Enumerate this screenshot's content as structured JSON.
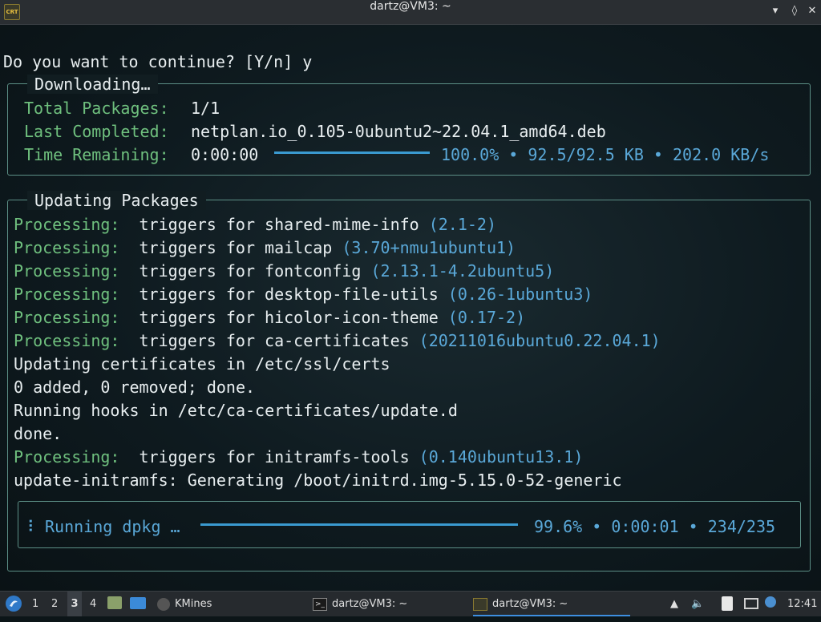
{
  "window": {
    "title": "dartz@VM3: ~",
    "app_icon": "CRT"
  },
  "terminal": {
    "prompt_line": "Do you want to continue? [Y/n] y",
    "downloading": {
      "legend": "Downloading…",
      "total_label": "Total Packages:",
      "total_value": "1/1",
      "last_label": "Last Completed:",
      "last_value": "netplan.io_0.105-0ubuntu2~22.04.1_amd64.deb",
      "remaining_label": "Time Remaining:",
      "remaining_value": "0:00:00",
      "progress": 1.0,
      "stats": "100.0% • 92.5/92.5 KB • 202.0 KB/s"
    },
    "updating": {
      "legend": "Updating Packages",
      "lines": [
        {
          "kind": "proc",
          "label": "Processing:",
          "text": "triggers for shared-mime-info ",
          "ver": "(2.1-2)"
        },
        {
          "kind": "proc",
          "label": "Processing:",
          "text": "triggers for mailcap ",
          "ver": "(3.70+nmu1ubuntu1)"
        },
        {
          "kind": "proc",
          "label": "Processing:",
          "text": "triggers for fontconfig ",
          "ver": "(2.13.1-4.2ubuntu5)"
        },
        {
          "kind": "proc",
          "label": "Processing:",
          "text": "triggers for desktop-file-utils ",
          "ver": "(0.26-1ubuntu3)"
        },
        {
          "kind": "proc",
          "label": "Processing:",
          "text": "triggers for hicolor-icon-theme ",
          "ver": "(0.17-2)"
        },
        {
          "kind": "proc",
          "label": "Processing:",
          "text": "triggers for ca-certificates ",
          "ver": "(20211016ubuntu0.22.04.1)"
        },
        {
          "kind": "plain",
          "text": "Updating certificates in /etc/ssl/certs"
        },
        {
          "kind": "plain",
          "text": "0 added, 0 removed; done."
        },
        {
          "kind": "plain",
          "text": "Running hooks in /etc/ca-certificates/update.d"
        },
        {
          "kind": "plain",
          "text": "done."
        },
        {
          "kind": "proc",
          "label": "Processing:",
          "text": "triggers for initramfs-tools ",
          "ver": "(0.140ubuntu13.1)"
        },
        {
          "kind": "plain",
          "text": "update-initramfs: Generating /boot/initrd.img-5.15.0-52-generic"
        }
      ],
      "dpkg_spinner": "⠸",
      "dpkg_label": "Running dpkg …",
      "dpkg_progress": 0.996,
      "dpkg_stats": "99.6% • 0:00:01 • 234/235"
    }
  },
  "taskbar": {
    "desktops": [
      "1",
      "2",
      "3",
      "4"
    ],
    "active_desktop": "3",
    "tasks": [
      {
        "label": "KMines",
        "icon": "kmines-icon"
      },
      {
        "label": "dartz@VM3: ~",
        "icon": "terminal-icon"
      },
      {
        "label": "dartz@VM3: ~",
        "icon": "cool-retro-term-icon",
        "active": true
      }
    ],
    "clock": "12:41",
    "accent": "#3d8ee0"
  }
}
